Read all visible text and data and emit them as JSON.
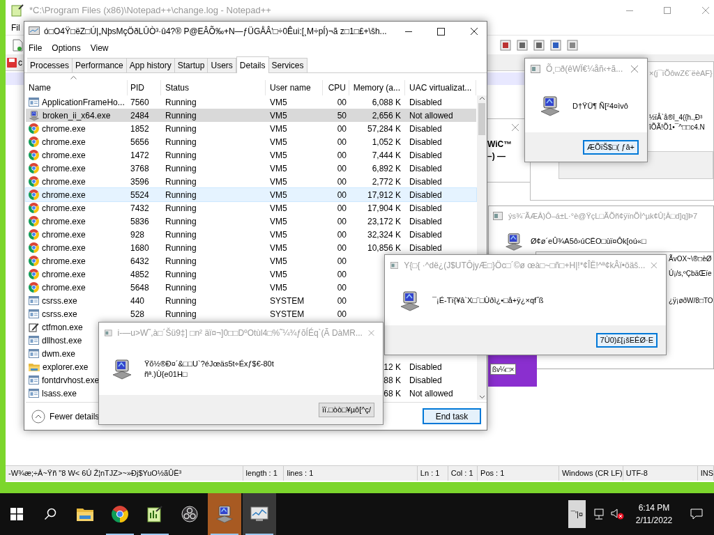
{
  "notepad": {
    "title": "*C:\\Program Files (x86)\\Notepad++\\change.log - Notepad++",
    "menu": "Fil",
    "tab_label": "c",
    "status": [
      "-W¾æ;÷Â~Ÿñ \"8 W< 6Ú Ž¦nTJZ>~»Ðj$YuO½ãÛË³",
      "length : 1",
      "lines : 1",
      "Ln : 1",
      "Col : 1",
      "Pos : 1",
      "Windows (CR LF)",
      "UTF-8",
      "INS"
    ]
  },
  "background_windows": [
    {
      "kind": "small",
      "lines": [
        "WiC™",
        "–) —"
      ]
    },
    {
      "kind": "wide",
      "title": "×(j¯ïÕôwZ€¨ëèAF}",
      "lines": [
        "½ïÂ`å®î_4({h.,Ð³",
        "îÕÃ!Õ1•¯^□□c4.N"
      ]
    },
    {
      "kind": "large",
      "title": "ýs¾¨ÃÆÂ)Ô–á±L·°è@ŸçL□ÃÕñ¢ÿïnÕÌ^µk¢Û¦Â□d]q]Þ7",
      "message": "Ø¢ø´eÛ¾A5ô›úCËO□ùï¤Ôk[oú«□",
      "lines": [
        "ÃvOX~\\®□èØ",
        "Ú¡/s,ºÇbäŒïe",
        "¿ÿ¡øðW/8□TO"
      ]
    },
    {
      "kind": "purple",
      "button": "ßv¼□×"
    }
  ],
  "task_manager": {
    "title": "ó□O4Ÿ□ëZ□Ú|„NþsMçÖðLÛÒ³·û4?® P@EÂÕ‰+N—ƒÜGÅÂ'□÷0Êui:[¸M÷pÍ)¬ã  z□1□£+\\šh...",
    "menu": [
      "File",
      "Options",
      "View"
    ],
    "tabs": [
      {
        "label": "Processes",
        "selected": false
      },
      {
        "label": "Performance",
        "selected": false
      },
      {
        "label": "App history",
        "selected": false
      },
      {
        "label": "Startup",
        "selected": false
      },
      {
        "label": "Users",
        "selected": false
      },
      {
        "label": "Details",
        "selected": true
      },
      {
        "label": "Services",
        "selected": false
      }
    ],
    "columns": [
      "Name",
      "PID",
      "Status",
      "User name",
      "CPU",
      "Memory (a...",
      "UAC virtualizat..."
    ],
    "rows": [
      {
        "kind": "window",
        "name": "ApplicationFrameHo...",
        "pid": "7560",
        "status": "Running",
        "user": "VM5",
        "cpu": "00",
        "memory": "6,088 K",
        "uac": "Disabled",
        "selected": false,
        "hover": false
      },
      {
        "kind": "computer",
        "name": "broken_ii_x64.exe",
        "pid": "2484",
        "status": "Running",
        "user": "VM5",
        "cpu": "50",
        "memory": "2,656 K",
        "uac": "Not allowed",
        "selected": true,
        "hover": false
      },
      {
        "kind": "chrome",
        "name": "chrome.exe",
        "pid": "1852",
        "status": "Running",
        "user": "VM5",
        "cpu": "00",
        "memory": "57,284 K",
        "uac": "Disabled",
        "selected": false,
        "hover": false
      },
      {
        "kind": "chrome",
        "name": "chrome.exe",
        "pid": "5656",
        "status": "Running",
        "user": "VM5",
        "cpu": "00",
        "memory": "1,052 K",
        "uac": "Disabled",
        "selected": false,
        "hover": false
      },
      {
        "kind": "chrome",
        "name": "chrome.exe",
        "pid": "1472",
        "status": "Running",
        "user": "VM5",
        "cpu": "00",
        "memory": "7,444 K",
        "uac": "Disabled",
        "selected": false,
        "hover": false
      },
      {
        "kind": "chrome",
        "name": "chrome.exe",
        "pid": "3768",
        "status": "Running",
        "user": "VM5",
        "cpu": "00",
        "memory": "6,892 K",
        "uac": "Disabled",
        "selected": false,
        "hover": false
      },
      {
        "kind": "chrome",
        "name": "chrome.exe",
        "pid": "3596",
        "status": "Running",
        "user": "VM5",
        "cpu": "00",
        "memory": "2,772 K",
        "uac": "Disabled",
        "selected": false,
        "hover": false
      },
      {
        "kind": "chrome",
        "name": "chrome.exe",
        "pid": "5524",
        "status": "Running",
        "user": "VM5",
        "cpu": "00",
        "memory": "17,912 K",
        "uac": "Disabled",
        "selected": false,
        "hover": true
      },
      {
        "kind": "chrome",
        "name": "chrome.exe",
        "pid": "7432",
        "status": "Running",
        "user": "VM5",
        "cpu": "00",
        "memory": "17,904 K",
        "uac": "Disabled",
        "selected": false,
        "hover": false
      },
      {
        "kind": "chrome",
        "name": "chrome.exe",
        "pid": "5836",
        "status": "Running",
        "user": "VM5",
        "cpu": "00",
        "memory": "23,172 K",
        "uac": "Disabled",
        "selected": false,
        "hover": false
      },
      {
        "kind": "chrome",
        "name": "chrome.exe",
        "pid": "928",
        "status": "Running",
        "user": "VM5",
        "cpu": "00",
        "memory": "32,324 K",
        "uac": "Disabled",
        "selected": false,
        "hover": false
      },
      {
        "kind": "chrome",
        "name": "chrome.exe",
        "pid": "1680",
        "status": "Running",
        "user": "VM5",
        "cpu": "00",
        "memory": "10,856 K",
        "uac": "Disabled",
        "selected": false,
        "hover": false
      },
      {
        "kind": "chrome",
        "name": "chrome.exe",
        "pid": "6432",
        "status": "Running",
        "user": "VM5",
        "cpu": "00",
        "selected": false,
        "hover": false
      },
      {
        "kind": "chrome",
        "name": "chrome.exe",
        "pid": "4852",
        "status": "Running",
        "user": "VM5",
        "cpu": "00",
        "selected": false,
        "hover": false
      },
      {
        "kind": "chrome",
        "name": "chrome.exe",
        "pid": "5648",
        "status": "Running",
        "user": "VM5",
        "cpu": "00",
        "selected": false,
        "hover": false
      },
      {
        "kind": "window",
        "name": "csrss.exe",
        "pid": "440",
        "status": "Running",
        "user": "SYSTEM",
        "cpu": "00",
        "selected": false,
        "hover": false
      },
      {
        "kind": "window",
        "name": "csrss.exe",
        "pid": "528",
        "status": "Running",
        "user": "SYSTEM",
        "cpu": "00",
        "selected": false,
        "hover": false
      },
      {
        "kind": "pen",
        "name": "ctfmon.exe",
        "selected": false,
        "hover": false
      },
      {
        "kind": "window",
        "name": "dllhost.exe",
        "selected": false,
        "hover": false
      },
      {
        "kind": "window",
        "name": "dwm.exe",
        "selected": false,
        "hover": false
      },
      {
        "kind": "folder",
        "name": "explorer.exe",
        "memory": "12 K",
        "uac": "Disabled",
        "selected": false,
        "hover": false
      },
      {
        "kind": "window",
        "name": "fontdrvhost.exe",
        "memory": "88 K",
        "uac": "Disabled",
        "selected": false,
        "hover": false
      },
      {
        "kind": "window",
        "name": "lsass.exe",
        "memory": "68 K",
        "uac": "Not allowed",
        "selected": false,
        "hover": false
      }
    ],
    "fewer_details": "Fewer details",
    "end_task": "End task"
  },
  "dialogs": [
    {
      "title": "Õ¸□ð(êWÏ€¼åñ‹+ã...",
      "message": [
        "D†ŸÜ¶  Ñ[²4¤ìvô"
      ],
      "button": "ÆÕïŠ$□(  ƒâ+"
    },
    {
      "title": "Y{□{ ·^dë¿(J$UTÔjyÆ□}Öc□´©ø œà□~□ñ□+H|!*¢ÎË!^ª¢kÂï•öäš...",
      "message": [
        "¯¡É-Tï{¥â`X□¨□Ùðì¿•□å+ÿ¿×qf˝ß"
      ],
      "button": "7Ù0)£[¡šEÊØ·E"
    },
    {
      "title": "i-—u>W˜,à□´Šü9‡] □n²  äï¤¬]0□□DºOtùl4□%˜¼¾ƒõÍÉq`(Ã DàMR...",
      "message": [
        "Ÿõ½®Ð¤´&□□U`?éJœäs5t÷Éxƒ$€-80t",
        "ñª.)Ù{e01H□"
      ],
      "button": "ïï.□òò□¥µô[^ç/"
    }
  ],
  "taskbar": {
    "apps": [
      {
        "kind": "explorer",
        "highlighted": false,
        "running": false
      },
      {
        "kind": "chrome",
        "highlighted": false,
        "running": true
      },
      {
        "kind": "notepad",
        "highlighted": false,
        "running": true
      },
      {
        "kind": "obs",
        "highlighted": false,
        "running": false
      },
      {
        "kind": "computer",
        "highlighted": true,
        "running": true
      },
      {
        "kind": "monitor",
        "highlighted": true,
        "running": true
      }
    ],
    "tray_text": "¯'|¤",
    "time": "6:14 PM",
    "date": "2/11/2022"
  }
}
